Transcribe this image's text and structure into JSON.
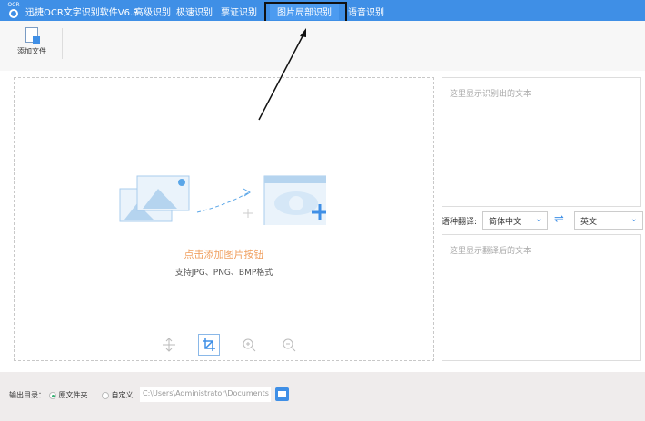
{
  "titlebar": {
    "logo_text": "OCR",
    "title": "迅捷OCR文字识别软件V6.8",
    "nav": [
      "高级识别",
      "极速识别",
      "票证识别",
      "图片局部识别",
      "语音识别"
    ]
  },
  "toolbar": {
    "add_file": "添加文件"
  },
  "drop": {
    "hint": "点击添加图片按钮",
    "formats": "支持JPG、PNG、BMP格式"
  },
  "result": {
    "placeholder": "这里显示识别出的文本"
  },
  "translate": {
    "label": "语种翻译:",
    "source": "简体中文",
    "target": "英文",
    "placeholder": "这里显示翻译后的文本"
  },
  "footer": {
    "label": "输出目录：",
    "opt1": "原文件夹",
    "opt2": "自定义",
    "path": "C:\\Users\\Administrator\\Documents"
  },
  "colors": {
    "accent": "#3f8fe6",
    "hint": "#f0a060"
  }
}
